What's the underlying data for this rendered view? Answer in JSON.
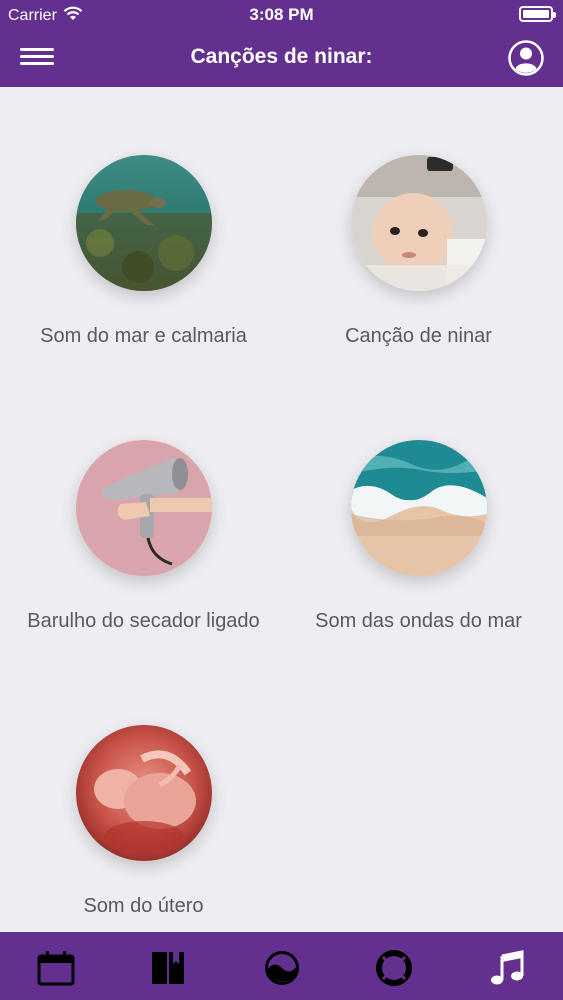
{
  "status_bar": {
    "carrier": "Carrier",
    "time": "3:08 PM"
  },
  "header": {
    "title": "Canções de ninar:"
  },
  "sounds": [
    {
      "label": "Som do mar e calmaria"
    },
    {
      "label": "Canção de ninar"
    },
    {
      "label": "Barulho do secador ligado"
    },
    {
      "label": "Som das ondas do mar"
    },
    {
      "label": "Som do útero"
    }
  ],
  "tabbar": {
    "tabs": [
      "calendar-icon",
      "book-icon",
      "moon-wave-icon",
      "lifebuoy-icon",
      "music-note-icon"
    ]
  },
  "colors": {
    "primary": "#64308f",
    "background": "#eeeef2",
    "label_text": "#5a5a5e"
  }
}
